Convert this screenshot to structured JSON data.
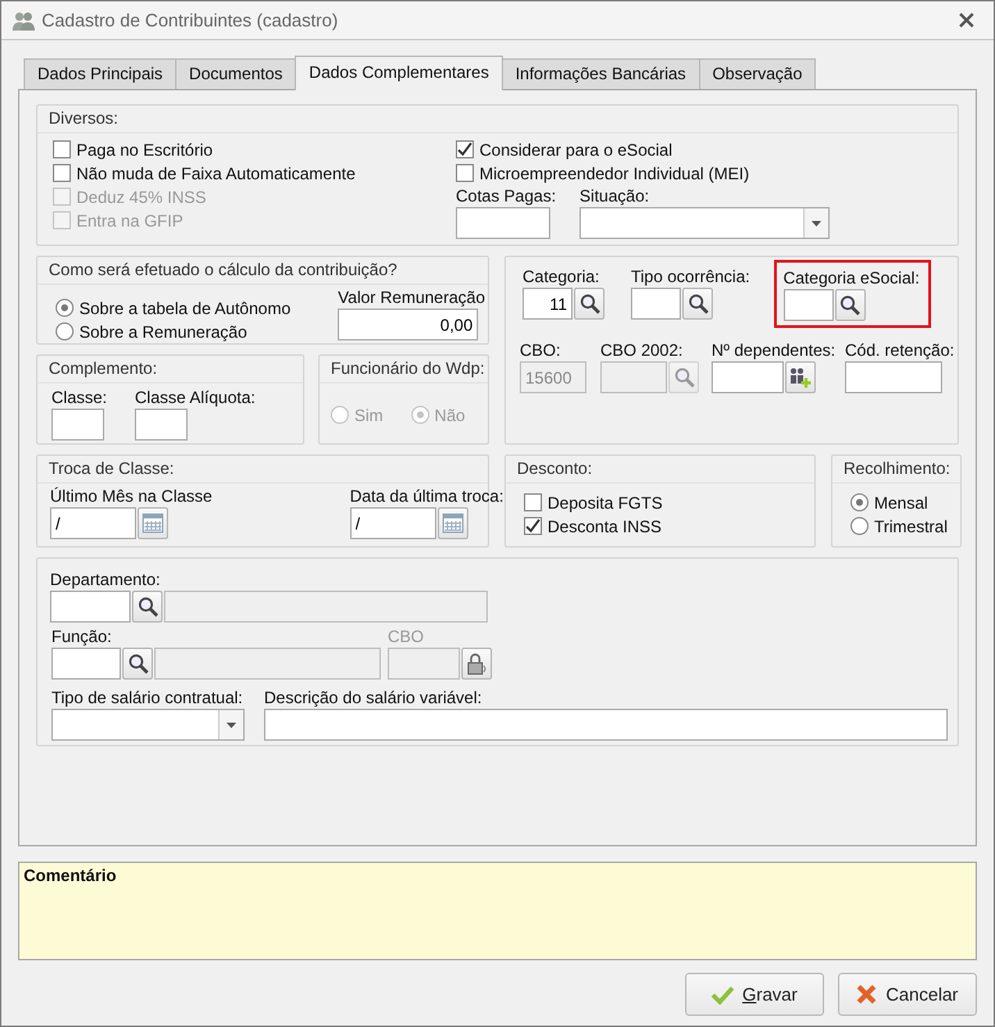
{
  "window": {
    "title": "Cadastro de Contribuintes (cadastro)"
  },
  "tabs": [
    {
      "label": "Dados Principais",
      "selected": false
    },
    {
      "label": "Documentos",
      "selected": false
    },
    {
      "label": "Dados Complementares",
      "selected": true
    },
    {
      "label": "Informações Bancárias",
      "selected": false
    },
    {
      "label": "Observação",
      "selected": false
    }
  ],
  "diversos": {
    "title": "Diversos:",
    "left_checkboxes": [
      {
        "label": "Paga no Escritório",
        "checked": false,
        "disabled": false
      },
      {
        "label": "Não muda de Faixa Automaticamente",
        "checked": false,
        "disabled": false
      },
      {
        "label": "Deduz 45% INSS",
        "checked": false,
        "disabled": true
      },
      {
        "label": "Entra na GFIP",
        "checked": false,
        "disabled": true
      }
    ],
    "right_checkboxes": [
      {
        "label": "Considerar para o eSocial",
        "checked": true,
        "disabled": false
      },
      {
        "label": "Microempreendedor Individual (MEI)",
        "checked": false,
        "disabled": false
      }
    ],
    "cotas_pagas": {
      "label": "Cotas Pagas:"
    },
    "situacao": {
      "label": "Situação:"
    }
  },
  "calculo": {
    "title": "Como será efetuado o cálculo da contribuição?",
    "options": [
      {
        "label": "Sobre a tabela de Autônomo",
        "selected": true
      },
      {
        "label": "Sobre a Remuneração",
        "selected": false
      }
    ],
    "valor_remuneracao": {
      "label": "Valor Remuneração",
      "value": "0,00"
    }
  },
  "complemento": {
    "title": "Complemento:",
    "classe": {
      "label": "Classe:"
    },
    "classe_aliquota": {
      "label": "Classe Alíquota:"
    }
  },
  "funcionario_wdp": {
    "title": "Funcionário do Wdp:",
    "options": [
      {
        "label": "Sim",
        "selected": false,
        "disabled": true
      },
      {
        "label": "Não",
        "selected": true,
        "disabled": true
      }
    ]
  },
  "categoria_panel": {
    "lookups": [
      {
        "label": "Categoria:",
        "value": "11",
        "highlighted": false
      },
      {
        "label": "Tipo ocorrência:",
        "highlighted": false
      },
      {
        "label": "Categoria eSocial:",
        "highlighted": true
      }
    ],
    "cbo": {
      "label": "CBO:",
      "value": "15600",
      "disabled": true
    },
    "cbo_2002": {
      "label": "CBO 2002:",
      "disabled": true
    },
    "n_dependentes": {
      "label": "Nº dependentes:"
    },
    "cod_retencao": {
      "label": "Cód. retenção:"
    }
  },
  "troca_classe": {
    "title": "Troca de Classe:",
    "dates": [
      {
        "label": "Último Mês na Classe",
        "value": "/"
      },
      {
        "label": "Data da última troca:",
        "value": "/"
      }
    ]
  },
  "desconto": {
    "title": "Desconto:",
    "checkboxes": [
      {
        "label": "Deposita FGTS",
        "checked": false
      },
      {
        "label": "Desconta INSS",
        "checked": true
      }
    ]
  },
  "recolhimento": {
    "title": "Recolhimento:",
    "options": [
      {
        "label": "Mensal",
        "selected": true
      },
      {
        "label": "Trimestral",
        "selected": false
      }
    ]
  },
  "lotacao": {
    "departamento": {
      "label": "Departamento:"
    },
    "funcao": {
      "label": "Função:"
    },
    "cbo": {
      "label": "CBO",
      "disabled": true
    },
    "tipo_salario": {
      "label": "Tipo de salário contratual:"
    },
    "descricao_salario": {
      "label": "Descrição do salário variável:"
    }
  },
  "comentario": {
    "label": "Comentário"
  },
  "buttons": [
    {
      "label": "Gravar",
      "kind": "save",
      "mnemonic": true
    },
    {
      "label": "Cancelar",
      "kind": "cancel",
      "mnemonic": false
    }
  ]
}
